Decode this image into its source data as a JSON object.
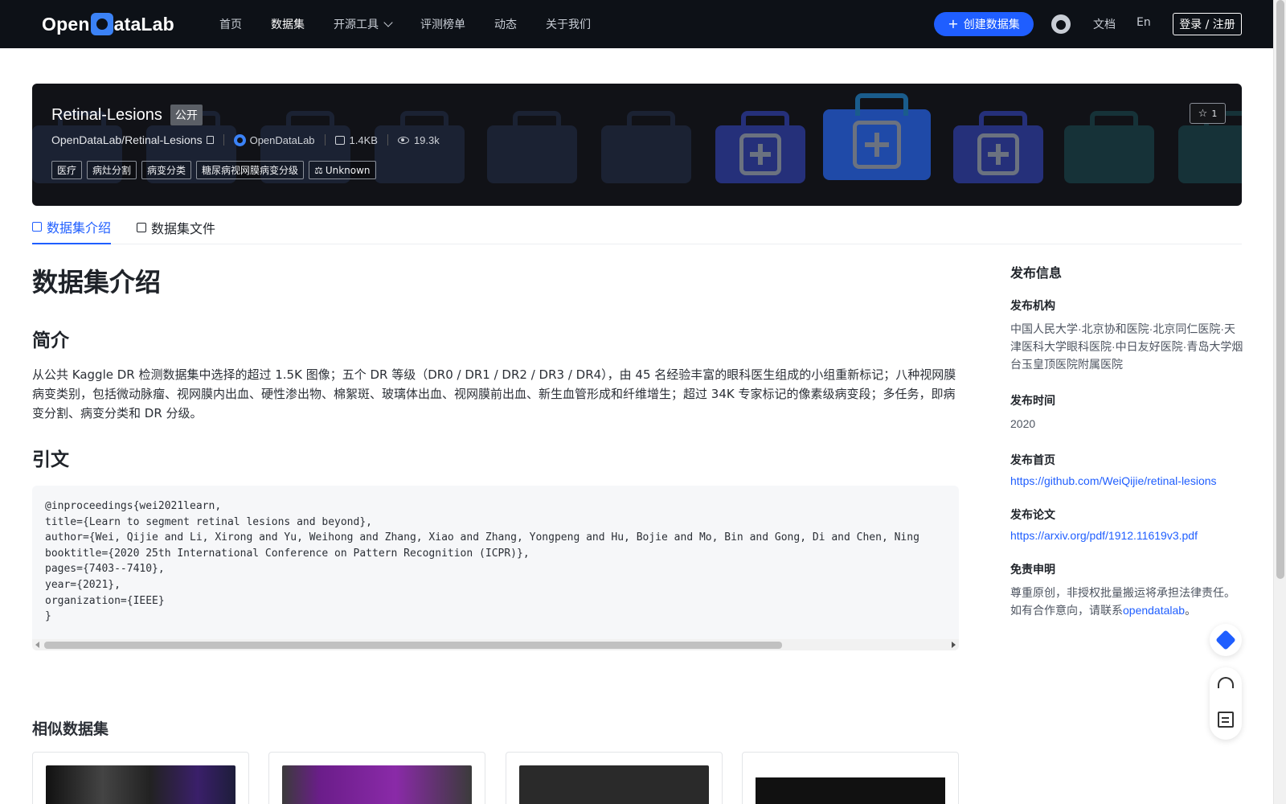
{
  "nav": {
    "logo_text_left": "Open",
    "logo_text_right": "ataLab",
    "items": [
      {
        "label": "首页"
      },
      {
        "label": "数据集"
      },
      {
        "label": "开源工具"
      },
      {
        "label": "评测榜单"
      },
      {
        "label": "动态"
      },
      {
        "label": "关于我们"
      }
    ],
    "create_label": "创建数据集",
    "docs_label": "文档",
    "lang_label": "En",
    "login_label": "登录 / 注册"
  },
  "banner": {
    "title": "Retinal-Lesions",
    "visibility": "公开",
    "repo": "OpenDataLab/Retinal-Lesions",
    "org": "OpenDataLab",
    "size": "1.4KB",
    "views": "19.3k",
    "tags": [
      "医疗",
      "病灶分割",
      "病变分类",
      "糖尿病视网膜病变分级"
    ],
    "license": "Unknown",
    "stars": "1"
  },
  "tabs": [
    {
      "label": "数据集介绍"
    },
    {
      "label": "数据集文件"
    }
  ],
  "main": {
    "heading": "数据集介绍",
    "intro_heading": "简介",
    "intro_text": "从公共 Kaggle DR 检测数据集中选择的超过 1.5K 图像；五个 DR 等级（DR0 / DR1 / DR2 / DR3 / DR4），由 45 名经验丰富的眼科医生组成的小组重新标记；八种视网膜病变类别，包括微动脉瘤、视网膜内出血、硬性渗出物、棉絮斑、玻璃体出血、视网膜前出血、新生血管形成和纤维增生；超过 34K 专家标记的像素级病变段；多任务，即病变分割、病变分类和 DR 分级。",
    "citation_heading": "引文",
    "citation": "@inproceedings{wei2021learn,\ntitle={Learn to segment retinal lesions and beyond},\nauthor={Wei, Qijie and Li, Xirong and Yu, Weihong and Zhang, Xiao and Zhang, Yongpeng and Hu, Bojie and Mo, Bin and Gong, Di and Chen, Ning\nbooktitle={2020 25th International Conference on Pattern Recognition (ICPR)},\npages={7403--7410},\nyear={2021},\norganization={IEEE}\n}",
    "similar_heading": "相似数据集"
  },
  "sidebar": {
    "title": "发布信息",
    "org_label": "发布机构",
    "org_value": "中国人民大学·北京协和医院·北京同仁医院·天津医科大学眼科医院·中日友好医院·青岛大学烟台玉皇顶医院附属医院",
    "time_label": "发布时间",
    "time_value": "2020",
    "home_label": "发布首页",
    "home_url": "https://github.com/WeiQijie/retinal-lesions",
    "paper_label": "发布论文",
    "paper_url": "https://arxiv.org/pdf/1912.11619v3.pdf",
    "disclaimer_label": "免责申明",
    "disclaimer_line1": "尊重原创，非授权批量搬运将承担法律责任。",
    "disclaimer_line2_prefix": "如有合作意向，请联系",
    "disclaimer_link": "opendatalab",
    "disclaimer_line2_suffix": "。"
  },
  "colors": {
    "nav_bg": "#0d1117",
    "accent": "#1f5eff",
    "banner_bg": "#111217"
  }
}
